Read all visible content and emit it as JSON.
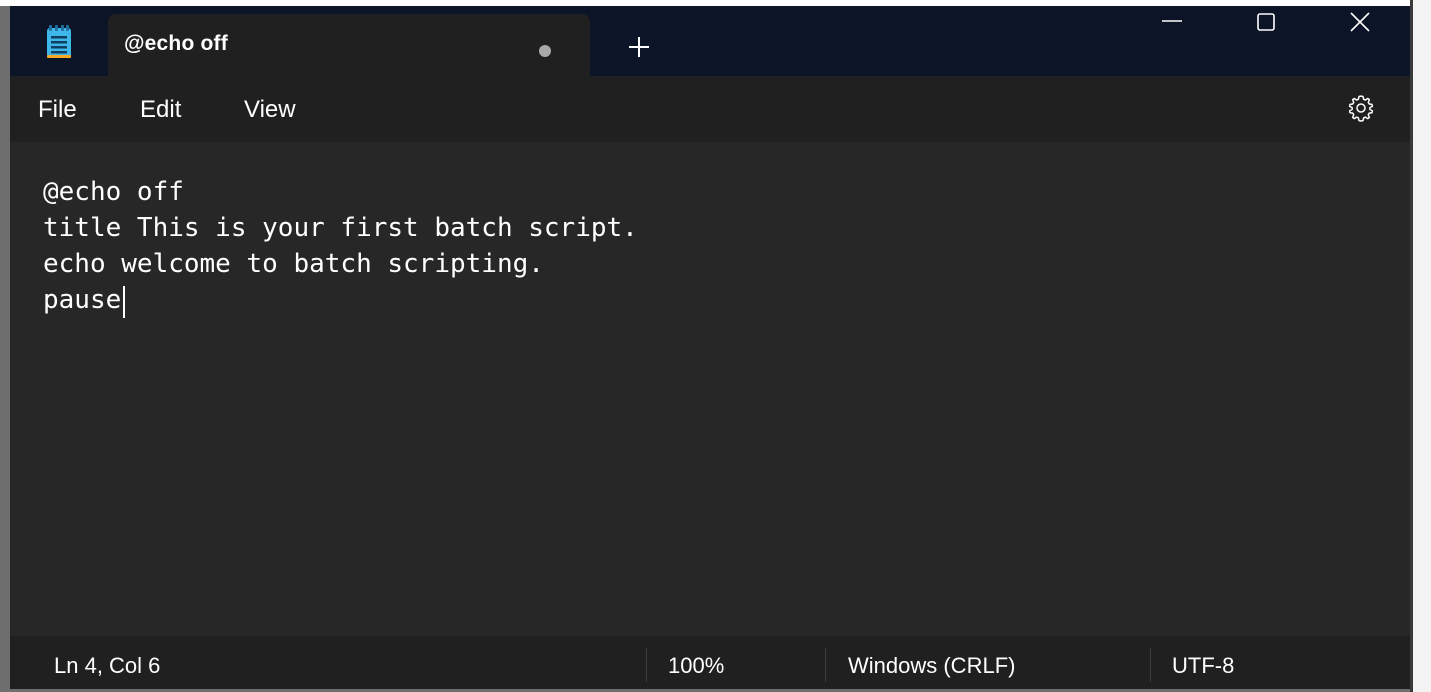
{
  "tab": {
    "title": "@echo off",
    "unsaved_indicator": "dot",
    "new_tab_icon": "plus-icon",
    "app_icon": "notepad-icon"
  },
  "window_controls": [
    "minimize-icon",
    "maximize-icon",
    "close-icon"
  ],
  "menu": {
    "items": [
      {
        "label": "File"
      },
      {
        "label": "Edit"
      },
      {
        "label": "View"
      }
    ],
    "settings_icon": "gear-icon"
  },
  "editor": {
    "lines": [
      "@echo off",
      "title This is your first batch script.",
      "echo welcome to batch scripting.",
      "pause"
    ]
  },
  "status": {
    "position": "Ln 4, Col 6",
    "zoom": "100%",
    "line_ending": "Windows (CRLF)",
    "encoding": "UTF-8"
  },
  "colors": {
    "titlebar": "#0c1428",
    "surface": "#202020",
    "editor": "#272727",
    "text": "#ffffff",
    "app_icon_accent": "#3fb6e8"
  }
}
